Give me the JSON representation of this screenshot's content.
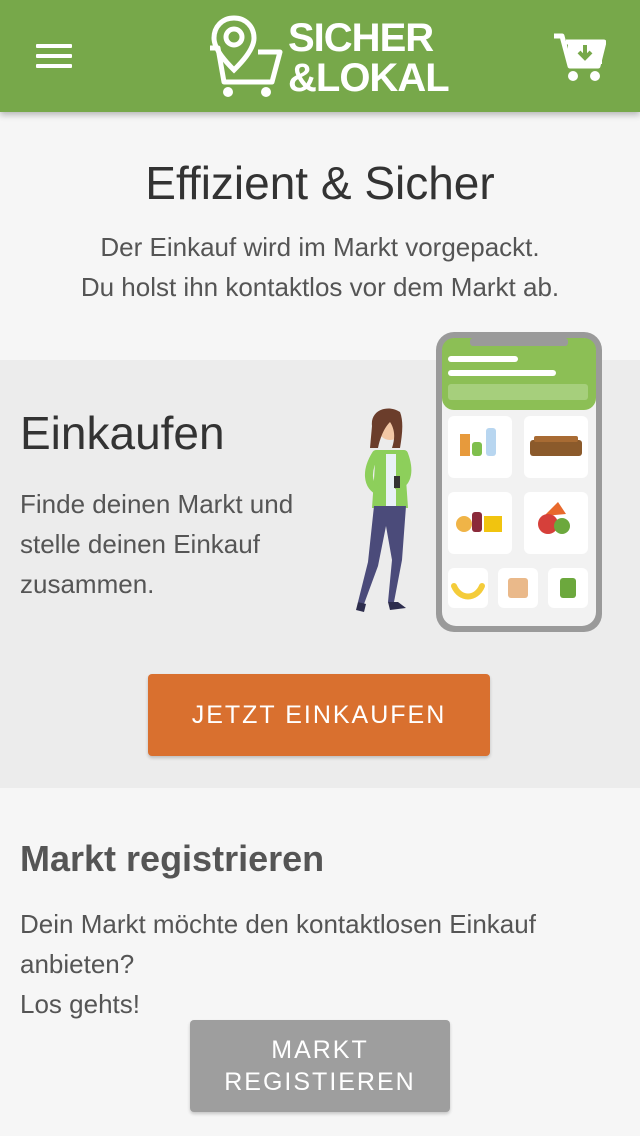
{
  "header": {
    "menu_icon": "hamburger-menu-icon",
    "logo_line1": "SICHER",
    "logo_line2": "&LOKAL",
    "cart_icon": "cart-download-icon"
  },
  "hero": {
    "title": "Effizient & Sicher",
    "line1": "Der Einkauf wird im Markt vorgepackt.",
    "line2": "Du holst ihn kontaktlos vor dem Markt ab."
  },
  "shop": {
    "title": "Einkaufen",
    "text": "Finde deinen Markt und stelle deinen Einkauf zusammen.",
    "button": "JETZT EINKAUFEN"
  },
  "register": {
    "title": "Markt registrieren",
    "line1": "Dein Markt möchte den kontaktlosen Einkauf anbieten?",
    "line2": "Los gehts!",
    "button_line1": "MARKT",
    "button_line2": "REGISTIEREN"
  },
  "colors": {
    "brand_green": "#77a84a",
    "accent_orange": "#d9702f",
    "secondary_gray": "#9e9e9e"
  }
}
